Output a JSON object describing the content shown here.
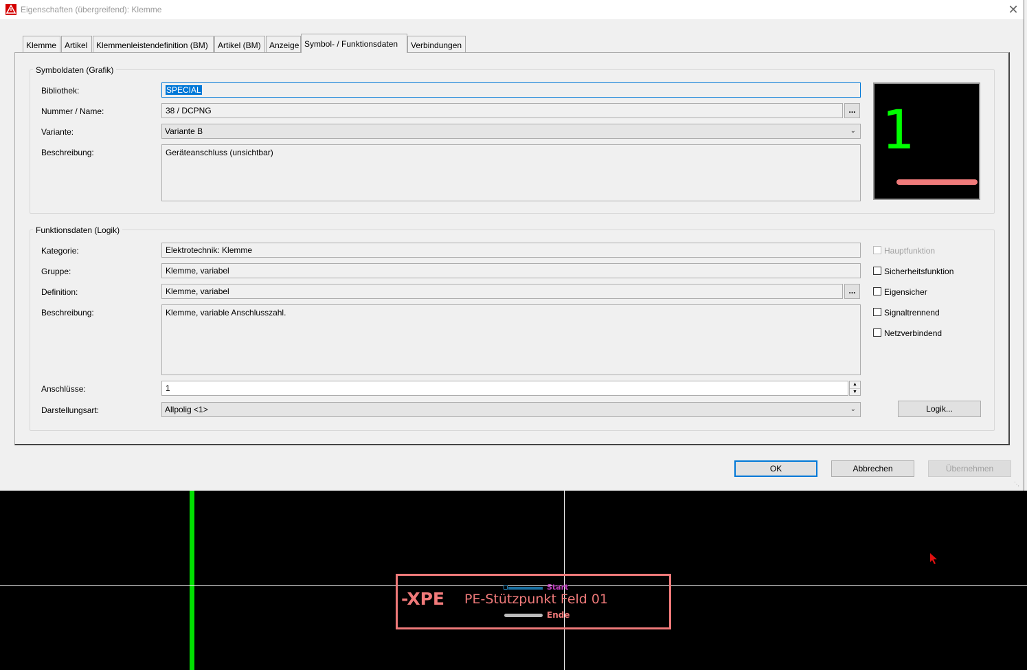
{
  "window": {
    "title": "Eigenschaften (übergreifend): Klemme",
    "close_glyph": "✕"
  },
  "tabs": [
    {
      "label": "Klemme"
    },
    {
      "label": "Artikel"
    },
    {
      "label": "Klemmenleistendefinition (BM)"
    },
    {
      "label": "Artikel (BM)"
    },
    {
      "label": "Anzeige"
    },
    {
      "label": "Symbol- / Funktionsdaten",
      "selected": true
    },
    {
      "label": "Verbindungen"
    }
  ],
  "symbol": {
    "legend": "Symboldaten (Grafik)",
    "bibliothek_label": "Bibliothek:",
    "bibliothek_value": "SPECIAL",
    "nummer_label": "Nummer / Name:",
    "nummer_value": "38 / DCPNG",
    "variante_label": "Variante:",
    "variante_value": "Variante B",
    "beschreibung_label": "Beschreibung:",
    "beschreibung_value": "Geräteanschluss (unsichtbar)",
    "browse_label": "...",
    "preview_digit": "1"
  },
  "funktion": {
    "legend": "Funktionsdaten (Logik)",
    "kategorie_label": "Kategorie:",
    "kategorie_value": "Elektrotechnik: Klemme",
    "gruppe_label": "Gruppe:",
    "gruppe_value": "Klemme, variabel",
    "definition_label": "Definition:",
    "definition_value": "Klemme, variabel",
    "beschreibung_label": "Beschreibung:",
    "beschreibung_value": "Klemme, variable Anschlusszahl.",
    "anschluesse_label": "Anschlüsse:",
    "anschluesse_value": "1",
    "darstellung_label": "Darstellungsart:",
    "darstellung_value": "Allpolig <1>",
    "browse_label": "...",
    "logik_button": "Logik...",
    "checkboxes": [
      {
        "label": "Hauptfunktion",
        "checked": false,
        "disabled": true
      },
      {
        "label": "Sicherheitsfunktion",
        "checked": false,
        "disabled": false
      },
      {
        "label": "Eigensicher",
        "checked": false,
        "disabled": false
      },
      {
        "label": "Signaltrennend",
        "checked": false,
        "disabled": false
      },
      {
        "label": "Netzverbindend",
        "checked": false,
        "disabled": false
      }
    ]
  },
  "buttons": {
    "ok": "OK",
    "cancel": "Abbrechen",
    "apply": "Übernehmen"
  },
  "cad": {
    "tag": "-XPE",
    "description": "PE-Stützpunkt Feld 01",
    "start_label": "Start",
    "end_label": "Ende",
    "colors": {
      "green_line": "#00e000",
      "highlight": "#f07a7a",
      "start": "#c040c0",
      "crosshair": "#ffffff"
    }
  }
}
